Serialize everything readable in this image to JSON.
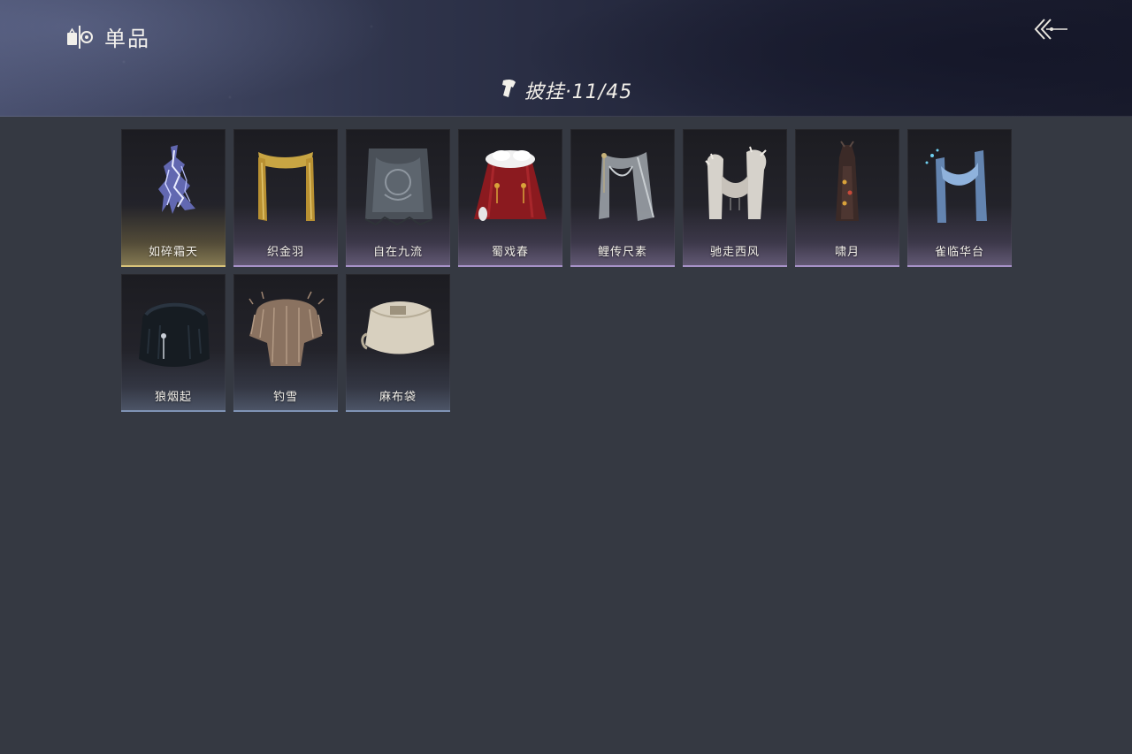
{
  "header": {
    "title": "单品",
    "category_label": "披挂·11/45",
    "icons": {
      "title_icon": "wardrobe-icon",
      "category_icon": "cape-icon",
      "back_icon": "back-arrow-icon"
    }
  },
  "items": [
    {
      "name": "如碎霜天",
      "rarity": "gold",
      "icon": "lightning-cape-icon"
    },
    {
      "name": "织金羽",
      "rarity": "purple",
      "icon": "gold-scarf-icon"
    },
    {
      "name": "自在九流",
      "rarity": "purple",
      "icon": "embroidered-cape-icon"
    },
    {
      "name": "蜀戏春",
      "rarity": "purple",
      "icon": "red-fur-cape-icon"
    },
    {
      "name": "鲤传尺素",
      "rarity": "purple",
      "icon": "grey-scarf-icon"
    },
    {
      "name": "驰走西风",
      "rarity": "purple",
      "icon": "white-fur-scarf-icon"
    },
    {
      "name": "啸月",
      "rarity": "purple",
      "icon": "dark-cape-icon"
    },
    {
      "name": "雀临华台",
      "rarity": "purple",
      "icon": "blue-scarf-icon"
    },
    {
      "name": "狼烟起",
      "rarity": "blue",
      "icon": "black-fur-cape-icon"
    },
    {
      "name": "钓雪",
      "rarity": "blue",
      "icon": "straw-cape-icon"
    },
    {
      "name": "麻布袋",
      "rarity": "blue",
      "icon": "sack-icon"
    }
  ],
  "colors": {
    "background": "#353942",
    "gold": "#d8c37a",
    "purple": "#a792c8",
    "blue": "#7f93b4"
  }
}
